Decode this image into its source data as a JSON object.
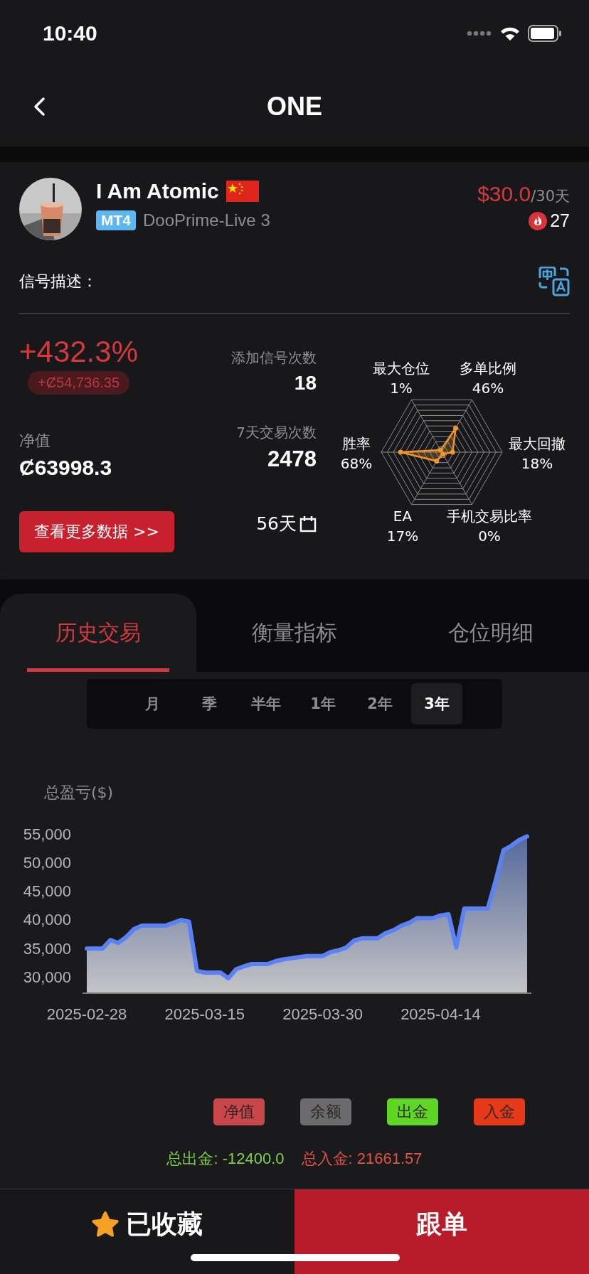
{
  "status_bar": {
    "time": "10:40"
  },
  "nav": {
    "title": "ONE"
  },
  "profile": {
    "name": "I Am Atomic",
    "platform": "MT4",
    "server": "DooPrime-Live 3",
    "price": "$30.0",
    "period": "/30天",
    "followers": "27",
    "description_label": "信号描述："
  },
  "stats": {
    "return": "+432.3%",
    "profit": "+Ȼ54,736.35",
    "equity_label": "净值",
    "equity": "Ȼ63998.3",
    "more_button": "查看更多数据 >>",
    "signal_adds_label": "添加信号次数",
    "signal_adds": "18",
    "trades_7d_label": "7天交易次数",
    "trades_7d": "2478",
    "days": "56天"
  },
  "radar": [
    {
      "label": "最大仓位",
      "value": "1%"
    },
    {
      "label": "多单比例",
      "value": "46%"
    },
    {
      "label": "胜率",
      "value": "68%"
    },
    {
      "label": "最大回撤",
      "value": "18%"
    },
    {
      "label": "EA",
      "value": "17%"
    },
    {
      "label": "手机交易比率",
      "value": "0%"
    }
  ],
  "tabs": [
    {
      "label": "历史交易",
      "selected": true
    },
    {
      "label": "衡量指标",
      "selected": false
    },
    {
      "label": "仓位明细",
      "selected": false
    }
  ],
  "ranges": [
    {
      "label": "月",
      "selected": false
    },
    {
      "label": "季",
      "selected": false
    },
    {
      "label": "半年",
      "selected": false
    },
    {
      "label": "1年",
      "selected": false
    },
    {
      "label": "2年",
      "selected": false
    },
    {
      "label": "3年",
      "selected": true
    }
  ],
  "chart": {
    "chart_data": {
      "type": "area",
      "ylabel": "总盈亏($)",
      "categories": [
        "2025-02-28",
        null,
        null,
        null,
        null,
        null,
        null,
        null,
        null,
        null,
        null,
        null,
        null,
        null,
        null,
        "2025-03-15",
        null,
        null,
        null,
        null,
        null,
        null,
        null,
        null,
        null,
        null,
        null,
        null,
        null,
        null,
        "2025-03-30",
        null,
        null,
        null,
        null,
        null,
        null,
        null,
        null,
        null,
        null,
        null,
        null,
        null,
        null,
        "2025-04-14",
        null,
        null,
        null,
        null,
        null,
        null,
        null,
        null,
        null,
        null,
        null
      ],
      "series": [
        {
          "color": "#5b82f5",
          "values": [
            35200,
            35200,
            35200,
            36700,
            36200,
            37200,
            38600,
            39200,
            39200,
            39200,
            39200,
            39700,
            40200,
            39900,
            31300,
            31000,
            31000,
            31000,
            30000,
            31600,
            32100,
            32500,
            32500,
            32500,
            33000,
            33300,
            33500,
            33700,
            33900,
            33900,
            33900,
            34600,
            34900,
            35400,
            36600,
            37000,
            37000,
            37000,
            37900,
            38400,
            39200,
            39700,
            40500,
            40500,
            40500,
            41000,
            41200,
            35400,
            42200,
            42200,
            42200,
            42200,
            47100,
            52400,
            53200,
            54200,
            54800
          ]
        }
      ],
      "ylim": [
        27400,
        55000
      ],
      "yticks": [
        {
          "value": 55000,
          "label": "55,000"
        },
        {
          "value": 50000,
          "label": "50,000"
        },
        {
          "value": 45000,
          "label": "45,000"
        },
        {
          "value": 40000,
          "label": "40,000"
        },
        {
          "value": 35000,
          "label": "35,000"
        },
        {
          "value": 30000,
          "label": "30,000"
        }
      ]
    }
  },
  "legend": [
    {
      "label": "净值",
      "color": "#c9474a"
    },
    {
      "label": "余额",
      "color": "#6b6b6e"
    },
    {
      "label": "出金",
      "color": "#5fd623"
    },
    {
      "label": "入金",
      "color": "#e5391a"
    }
  ],
  "totals": {
    "withdrawal": "总出金: -12400.0",
    "deposit": "总入金: 21661.57"
  },
  "bottom_bar": {
    "favorite": "已收藏",
    "follow": "跟单"
  }
}
